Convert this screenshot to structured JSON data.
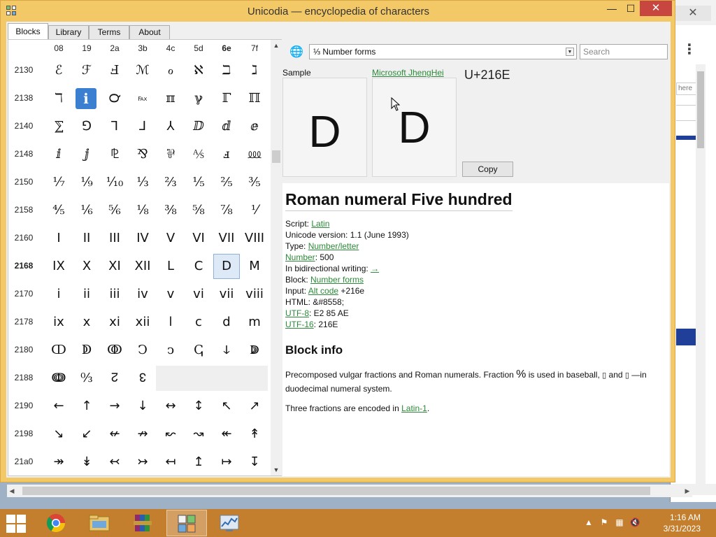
{
  "window": {
    "title": "Unicodia — encyclopedia of characters",
    "minimize": "—",
    "maximize": "☐",
    "close": "✕"
  },
  "tabs": [
    "Blocks",
    "Library",
    "Terms",
    "About"
  ],
  "grid": {
    "columns": [
      "08",
      "19",
      "2a",
      "3b",
      "4c",
      "5d",
      "6e",
      "7f"
    ],
    "bold_column": "6e",
    "rows": [
      {
        "label": "2130",
        "cells": [
          "ℰ",
          "ℱ",
          "Ⅎ",
          "ℳ",
          "ℴ",
          "ℵ",
          "ℶ",
          "ℷ"
        ]
      },
      {
        "label": "2138",
        "cells": [
          "ℸ",
          "ℹ",
          "℺",
          "℻",
          "ℼ",
          "ℽ",
          "ℾ",
          "ℿ"
        ]
      },
      {
        "label": "2140",
        "cells": [
          "⅀",
          "⅁",
          "⅂",
          "⅃",
          "⅄",
          "ⅅ",
          "ⅆ",
          "ⅇ"
        ]
      },
      {
        "label": "2148",
        "cells": [
          "ⅈ",
          "ⅉ",
          "⅊",
          "⅋",
          "⅌",
          "⅍",
          "ⅎ",
          "⅏"
        ]
      },
      {
        "label": "2150",
        "cells": [
          "⅐",
          "⅑",
          "⅒",
          "⅓",
          "⅔",
          "⅕",
          "⅖",
          "⅗"
        ]
      },
      {
        "label": "2158",
        "cells": [
          "⅘",
          "⅙",
          "⅚",
          "⅛",
          "⅜",
          "⅝",
          "⅞",
          "⅟"
        ]
      },
      {
        "label": "2160",
        "cells": [
          "I",
          "II",
          "III",
          "IV",
          "V",
          "VI",
          "VII",
          "VIII"
        ]
      },
      {
        "label": "2168",
        "cells": [
          "IX",
          "X",
          "XI",
          "XII",
          "L",
          "C",
          "D",
          "M"
        ]
      },
      {
        "label": "2170",
        "cells": [
          "i",
          "ii",
          "iii",
          "iv",
          "v",
          "vi",
          "vii",
          "viii"
        ]
      },
      {
        "label": "2178",
        "cells": [
          "ix",
          "x",
          "xi",
          "xii",
          "l",
          "c",
          "d",
          "m"
        ]
      },
      {
        "label": "2180",
        "cells": [
          "ↀ",
          "ↁ",
          "ↂ",
          "Ↄ",
          "ↄ",
          "ↅ",
          "ↆ",
          "ↇ"
        ]
      },
      {
        "label": "2188",
        "cells": [
          "ↈ",
          "↉",
          "↊",
          "↋",
          "",
          "",
          "",
          ""
        ]
      },
      {
        "label": "2190",
        "cells": [
          "←",
          "↑",
          "→",
          "↓",
          "↔",
          "↕",
          "↖",
          "↗"
        ]
      },
      {
        "label": "2198",
        "cells": [
          "↘",
          "↙",
          "↚",
          "↛",
          "↜",
          "↝",
          "↞",
          "↟"
        ]
      },
      {
        "label": "21a0",
        "cells": [
          "↠",
          "↡",
          "↢",
          "↣",
          "↤",
          "↥",
          "↦",
          "↧"
        ]
      }
    ],
    "bold_row": "2168",
    "selected": {
      "row": 7,
      "col": 6
    },
    "info_cell": {
      "row": 1,
      "col": 1
    }
  },
  "detail": {
    "block_select_value": "⅓ Number forms",
    "search_placeholder": "Search",
    "sample_label": "Sample",
    "font_name": "Microsoft JhengHei",
    "codepoint": "U+216E",
    "glyph": "D",
    "copy_label": "Copy",
    "name": "Roman numeral Five hundred",
    "properties": {
      "script_label": "Script: ",
      "script_value": "Latin",
      "version_label": "Unicode version: 1.1 (June 1993)",
      "type_label": "Type: ",
      "type_value": "Number/letter",
      "number_link": "Number",
      "number_value": ": 500",
      "bidi_label": "In bidirectional writing: ",
      "bidi_value": "→",
      "block_label": "Block: ",
      "block_value": "Number forms",
      "input_label": "Input: ",
      "input_link": "Alt code",
      "input_value": " +216e",
      "html_label": "HTML: &#8558;",
      "utf8_link": "UTF-8",
      "utf8_value": ": E2 85 AE",
      "utf16_link": "UTF-16",
      "utf16_value": ": 216E"
    },
    "block_info_heading": "Block info",
    "block_desc_1": "Precomposed vulgar fractions and Roman numerals. Fraction ",
    "block_desc_frac": "%",
    "block_desc_2": " is used in baseball, ",
    "block_desc_box1": "▯",
    "block_desc_3": " and ",
    "block_desc_box2": "▯",
    "block_desc_4": " —in duodecimal numeral system.",
    "latin_note_1": "Three fractions are encoded in ",
    "latin_note_link": "Latin-1",
    "latin_note_2": "."
  },
  "background_window": {
    "close": "✕",
    "menu": "⋮",
    "field_text": "here"
  },
  "taskbar": {
    "apps": [
      "chrome",
      "file-explorer",
      "winrar",
      "unicodia",
      "performance-monitor"
    ],
    "active_app": "unicodia",
    "time": "1:16 AM",
    "date": "3/31/2023"
  }
}
